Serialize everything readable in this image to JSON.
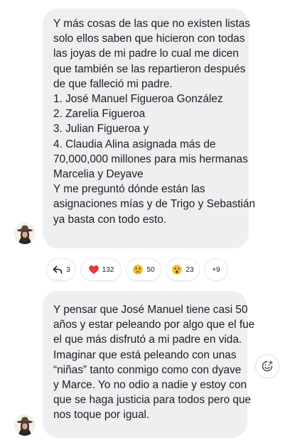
{
  "messages": [
    {
      "lines": [
        "Y más cosas de las que no existen listas",
        "solo ellos saben que hicieron con todas",
        "las joyas de mi padre lo cual me dicen",
        "que también se las repartieron después",
        "de que falleció mi padre.",
        "1. José Manuel Figueroa González",
        "2. Zarelia Figueroa",
        "3. Julian Figueroa y",
        "4. Claudia Alina asignada más de",
        "70,000,000 millones para mis hermanas",
        "Marcelia y Deyave",
        "Y me preguntó dónde están las",
        "asignaciones mías y de Trigo y Sebastián",
        "ya basta con todo esto."
      ]
    },
    {
      "lines": [
        "Y pensar que José Manuel tiene casi 50",
        "años y estar peleando por algo que el fue",
        "el que más disfrutó a mi padre en vida.",
        "Imaginar que está peleando con unas",
        "“niñas” tanto conmigo como con dyave",
        "y Marce. Yo no odio a nadie y estoy con",
        "que se haga justicia para todos pero que",
        "nos toque por igual."
      ]
    }
  ],
  "reactions": {
    "replies": "3",
    "heart": "132",
    "sad": "50",
    "wow": "23",
    "more": "+9"
  },
  "icons": {
    "reply": "reply-arrow-icon",
    "heart": "heart-icon",
    "sad": "sad-face-icon",
    "wow": "wow-face-icon",
    "add": "add-reaction-icon"
  },
  "colors": {
    "bubble": "#eeeff1",
    "heart": "#e8373e",
    "emoji": "#f5c33b"
  }
}
